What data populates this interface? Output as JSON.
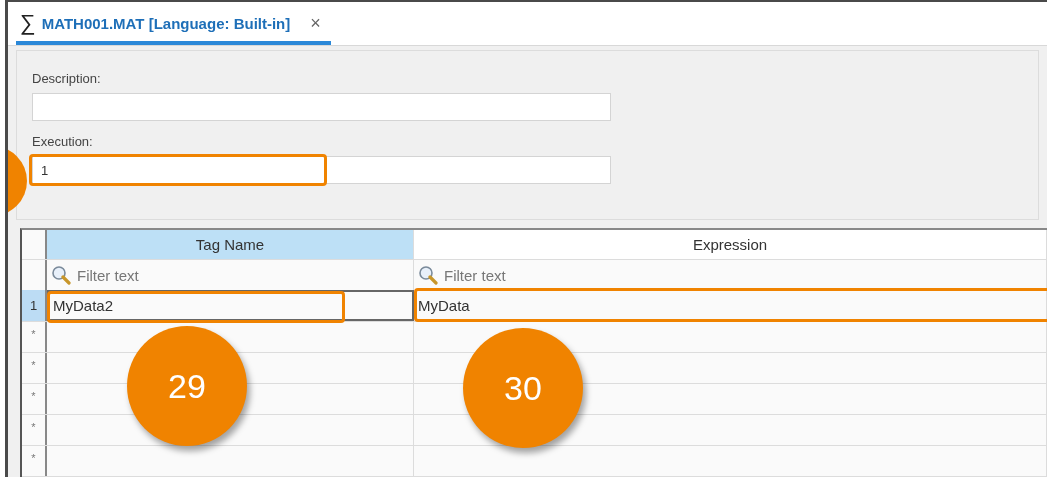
{
  "tab": {
    "icon": "∑",
    "title": "MATH001.MAT [Language: Built-in]",
    "close": "×",
    "selected": true
  },
  "form": {
    "fields": [
      {
        "label": "Description:"
      },
      {
        "label": "Execution:",
        "value": "1",
        "highlighted": true
      }
    ]
  },
  "grid": {
    "columns": [
      {
        "title": "Tag Name",
        "selected": true
      },
      {
        "title": "Expression",
        "selected": false
      }
    ],
    "filters": [
      {
        "placeholder": "Filter text"
      },
      {
        "placeholder": "Filter text"
      }
    ],
    "rows": [
      {
        "header": "1",
        "selected": true,
        "cells": [
          {
            "text": "MyData2",
            "highlighted": true
          },
          {
            "text": "MyData",
            "highlighted": true
          }
        ]
      },
      {
        "header": "*",
        "selected": false
      },
      {
        "header": "*",
        "selected": false
      },
      {
        "header": "*",
        "selected": false
      },
      {
        "header": "*",
        "selected": false
      },
      {
        "header": "*",
        "selected": false
      }
    ]
  },
  "callouts": [
    {
      "label": "29"
    },
    {
      "label": "30"
    }
  ]
}
